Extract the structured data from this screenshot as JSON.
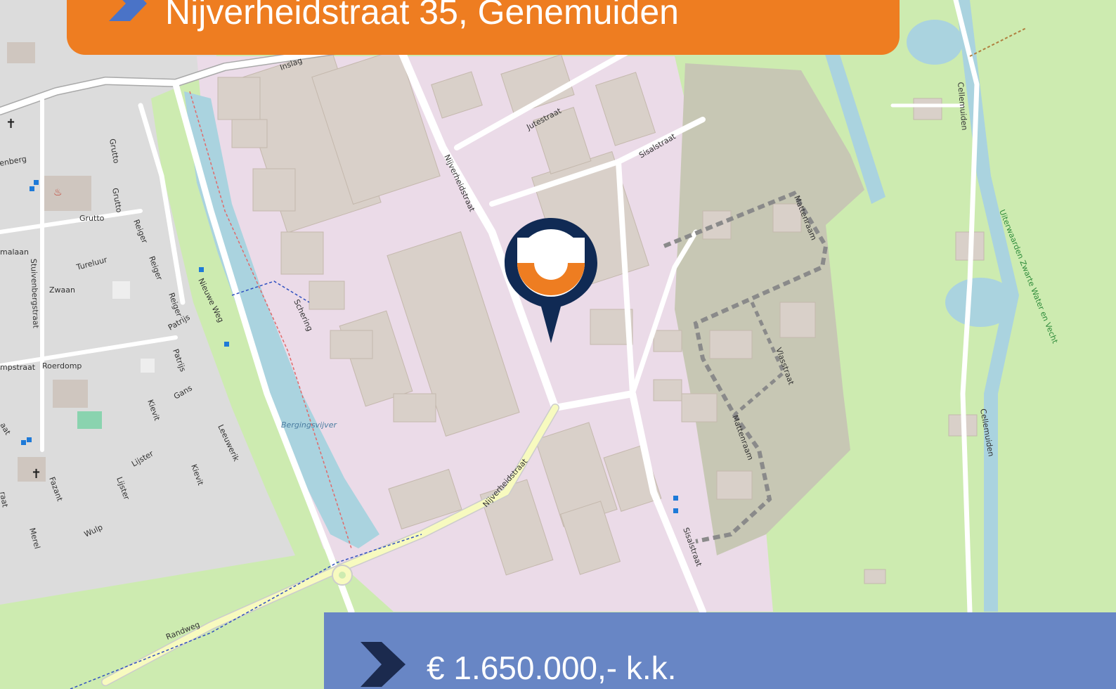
{
  "header": {
    "address": "Nijverheidstraat 35, Genemuiden",
    "color": "#ee7d21"
  },
  "price_panel": {
    "price": "€ 1.650.000,- k.k.",
    "color": "#6886c5",
    "chevron_color": "#1b2a4e"
  },
  "marker": {
    "icon": "location-pin-icon",
    "pin_color": "#102a54",
    "accent_color": "#ee7d21"
  },
  "map": {
    "landuse_colors": {
      "industrial": "#ebdbe8",
      "residential": "#dcdcdc",
      "grass": "#cdebb0",
      "water": "#aad3df",
      "building": "#d9d0c9",
      "construction": "#c7c7b4"
    },
    "labels": {
      "inslag": "Inslag",
      "jutestraat": "Jutestraat",
      "sisalstraat_n": "Sisalstraat",
      "nijverheidstraat_n": "Nijverheidstraat",
      "nijverheidstraat_s": "Nijverheidstraat",
      "mattenraam_n": "Mattenraam",
      "mattenraam_s": "Mattenraam",
      "vlasstraat": "Vlasstraat",
      "sisalstraat_s": "Sisalstraat",
      "cellemuiden_n": "Cellemuiden",
      "cellemuiden_s": "Cellemuiden",
      "uiterwaarden": "Uiterwaarden Zwarte Water en Vecht",
      "bergingsvijver": "Bergingsvijver",
      "schering": "Schering",
      "nieuwe_weg": "Nieuwe Weg",
      "randweg": "Randweg",
      "grutto_1": "Grutto",
      "grutto_2": "Grutto",
      "grutto_3": "Grutto",
      "reiger_1": "Reiger",
      "reiger_2": "Reiger",
      "reiger_3": "Reiger",
      "tureluur": "Tureluur",
      "zwaan": "Zwaan",
      "patrijs_1": "Patrijs",
      "patrijs_2": "Patrijs",
      "roerdomp": "Roerdomp",
      "gans": "Gans",
      "kievit_1": "Kievit",
      "kievit_2": "Kievit",
      "leeuwerik": "Leeuwerik",
      "lijster_1": "Lijster",
      "lijster_2": "Lijster",
      "fazant": "Fazant",
      "wulp": "Wulp",
      "merel": "Merel",
      "stuivenbergstraat": "Stuivenbergstraat",
      "enberg": "enberg",
      "malaan": "malaan",
      "mpstraat": "mpstraat",
      "aat": "aat",
      "raat": "raat"
    }
  }
}
